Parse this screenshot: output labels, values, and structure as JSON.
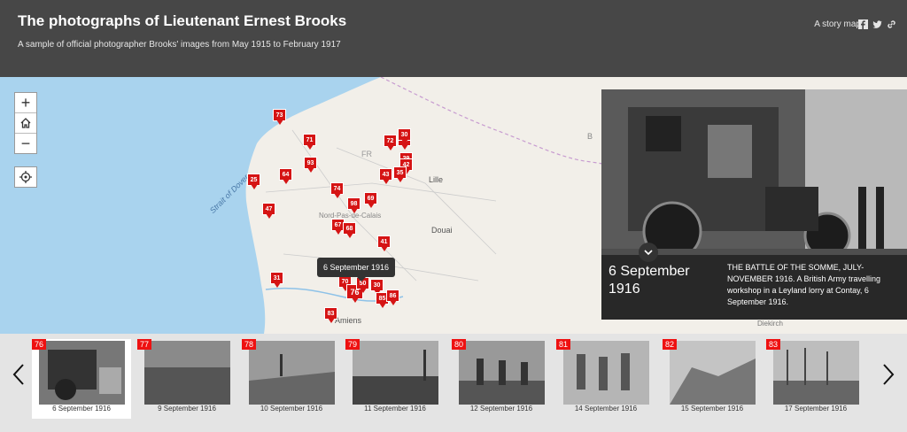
{
  "header": {
    "title": "The photographs of Lieutenant Ernest Brooks",
    "subtitle": "A sample of official photographer Brooks' images from May 1915 to February 1917",
    "story_link": "A story map",
    "share_icons": [
      "facebook-icon",
      "twitter-icon",
      "link-icon"
    ]
  },
  "map": {
    "labels": {
      "strait": "Strait of Dover",
      "lille": "Lille",
      "douai": "Douai",
      "region": "Nord-Pas-de-Calais",
      "amiens": "Amiens",
      "b": "B",
      "fr": "FR",
      "diekirch": "Diekirch"
    },
    "markers": [
      "73",
      "71",
      "72",
      "40",
      "93",
      "30",
      "29",
      "42",
      "64",
      "43",
      "35",
      "25",
      "74",
      "98",
      "69",
      "47",
      "67",
      "68",
      "41",
      "31",
      "70",
      "76",
      "50",
      "30",
      "85",
      "86",
      "83"
    ],
    "tooltip": "6 September 1916",
    "colors": {
      "water": "#a9d3ee",
      "land": "#f2efe9",
      "marker": "#d51414"
    }
  },
  "controls": {
    "zoom_in": "+",
    "zoom_out": "−",
    "home_icon": "home-icon",
    "locate_icon": "locate-icon"
  },
  "card": {
    "date": "6 September 1916",
    "text": "THE BATTLE OF THE SOMME, JULY-NOVEMBER 1916. A British Army travelling workshop in a Leyland lorry at Contay, 6 September 1916."
  },
  "strip": {
    "thumbs": [
      {
        "num": "76",
        "date": "6 September 1916"
      },
      {
        "num": "77",
        "date": "9 September 1916"
      },
      {
        "num": "78",
        "date": "10 September 1916"
      },
      {
        "num": "79",
        "date": "11 September 1916"
      },
      {
        "num": "80",
        "date": "12 September 1916"
      },
      {
        "num": "81",
        "date": "14 September 1916"
      },
      {
        "num": "82",
        "date": "15 September 1916"
      },
      {
        "num": "83",
        "date": "17 September 1916"
      }
    ],
    "active_index": 0
  }
}
